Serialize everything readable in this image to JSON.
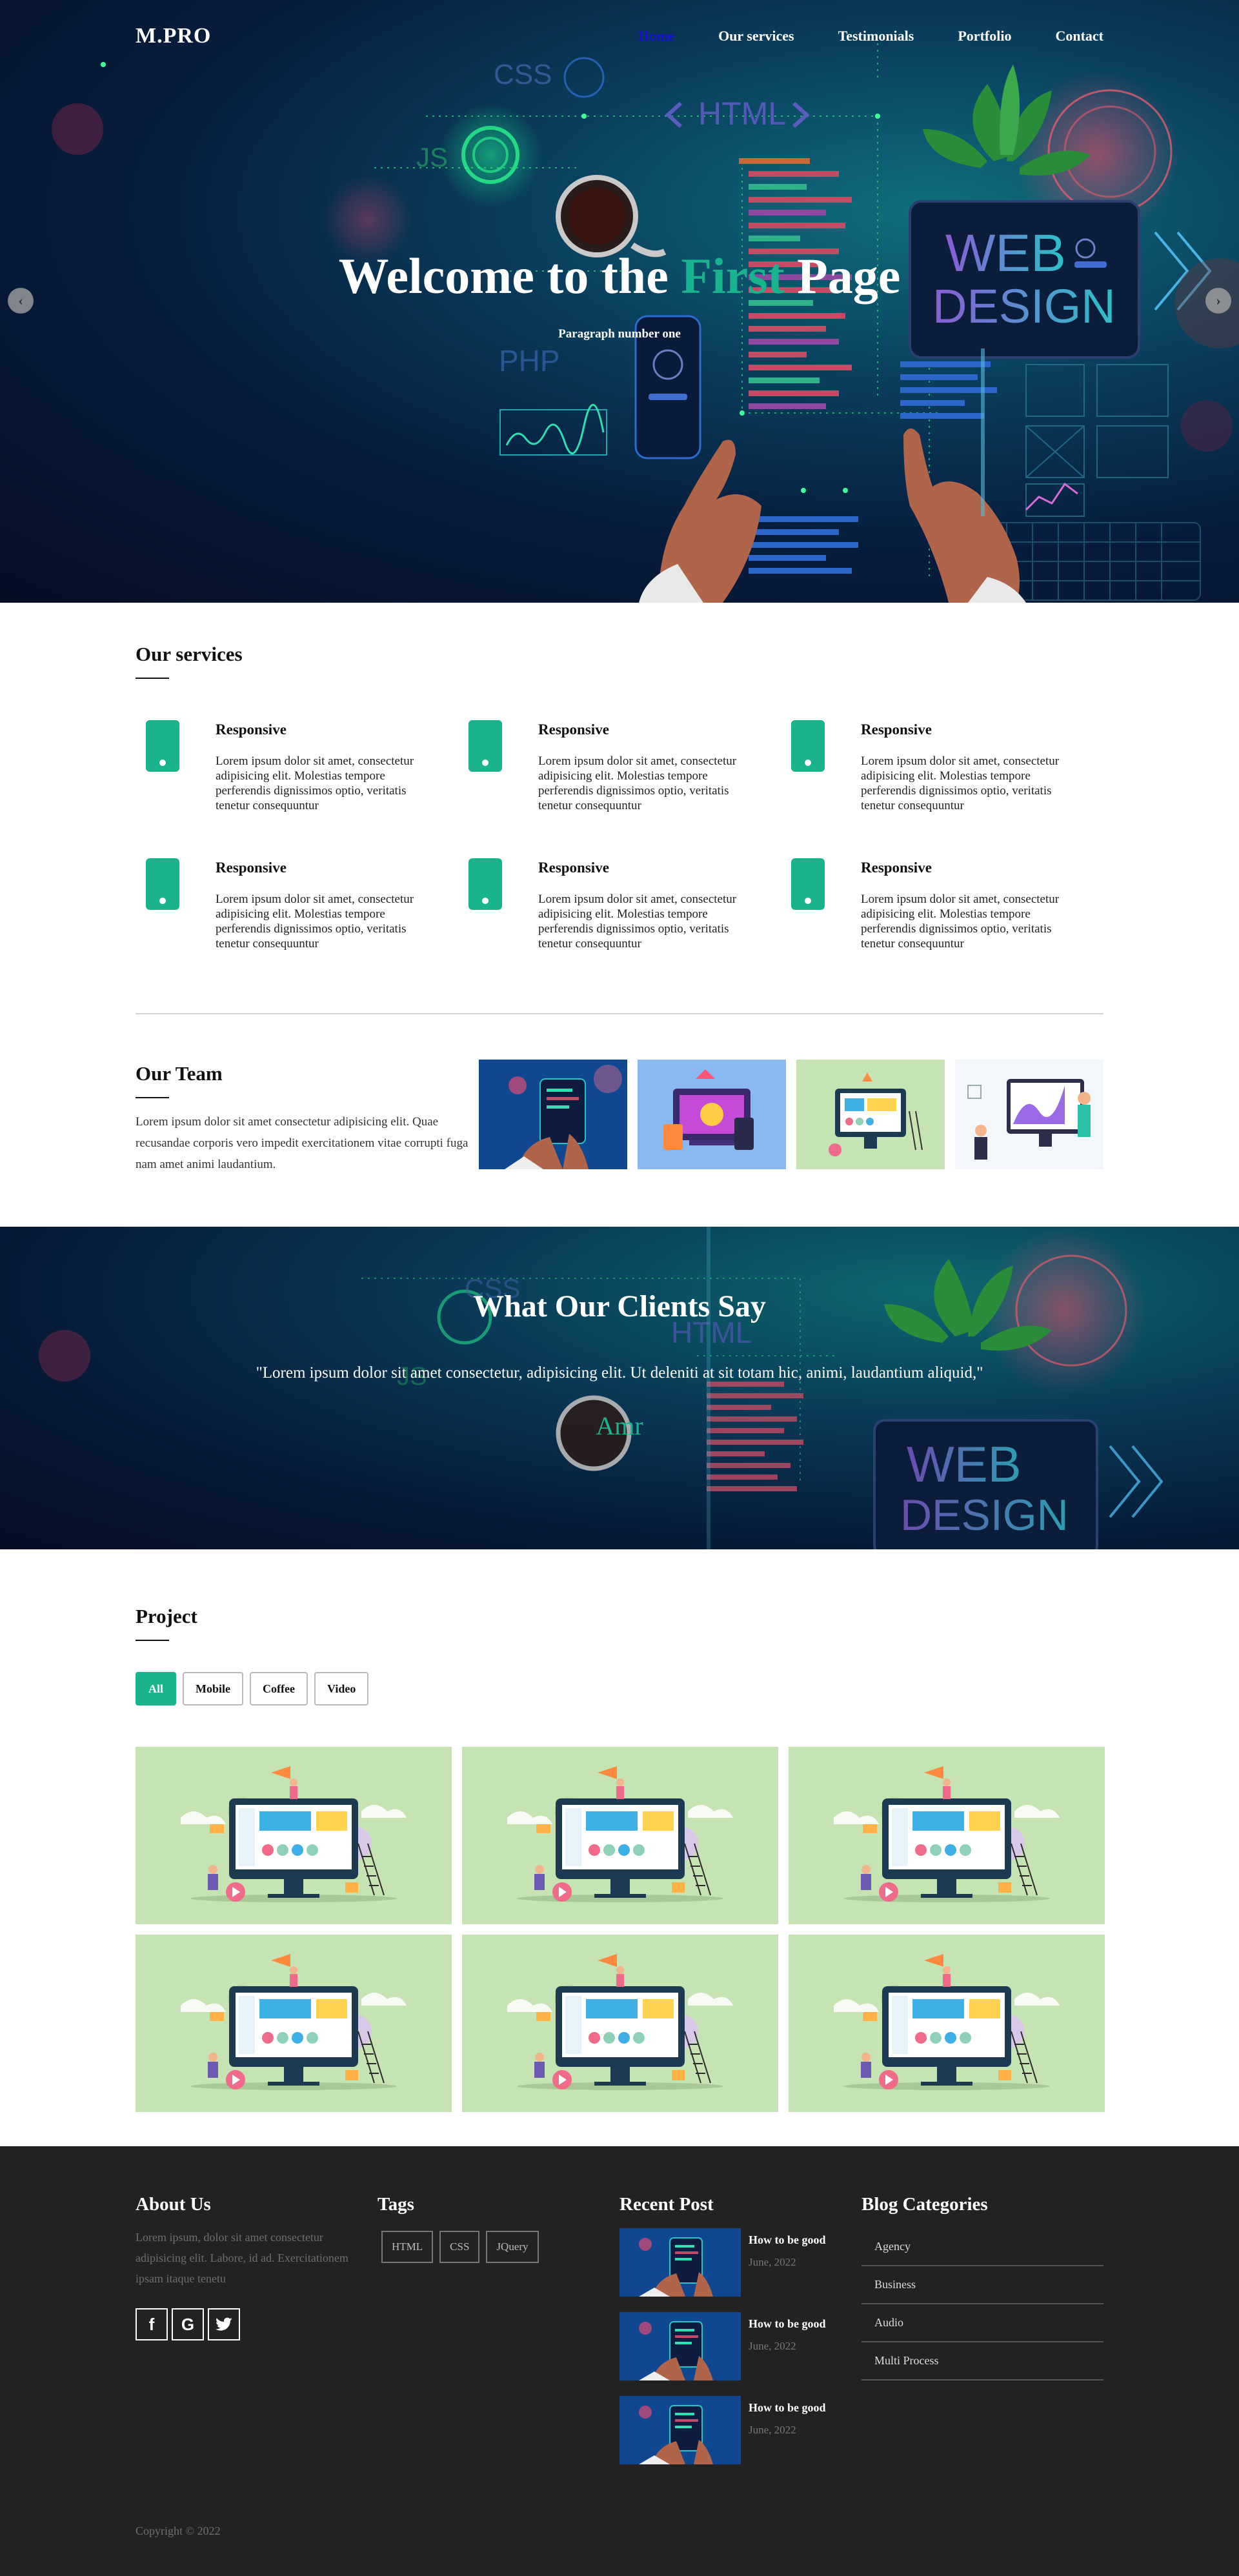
{
  "nav": {
    "logo": "M.PRO",
    "links": [
      "Home",
      "Our services",
      "Testimonials",
      "Portfolio",
      "Contact"
    ]
  },
  "hero": {
    "title_before": "Welcome to the ",
    "title_accent": "First",
    "title_after": " Page",
    "subtitle": "Paragraph number one",
    "prev_icon": "chevron-left-icon",
    "next_icon": "chevron-right-icon",
    "art_labels": {
      "css": "CSS",
      "html": "HTML",
      "js": "JS",
      "php": "PHP",
      "web": "WEB",
      "design": "DESIGN"
    }
  },
  "services": {
    "title": "Our services",
    "icon": "mobile-phone-icon",
    "items": [
      {
        "title": "Responsive",
        "text": "Lorem ipsum dolor sit amet, consectetur adipisicing elit. Molestias tempore perferendis dignissimos optio, veritatis tenetur consequuntur"
      },
      {
        "title": "Responsive",
        "text": "Lorem ipsum dolor sit amet, consectetur adipisicing elit. Molestias tempore perferendis dignissimos optio, veritatis tenetur consequuntur"
      },
      {
        "title": "Responsive",
        "text": "Lorem ipsum dolor sit amet, consectetur adipisicing elit. Molestias tempore perferendis dignissimos optio, veritatis tenetur consequuntur"
      },
      {
        "title": "Responsive",
        "text": "Lorem ipsum dolor sit amet, consectetur adipisicing elit. Molestias tempore perferendis dignissimos optio, veritatis tenetur consequuntur"
      },
      {
        "title": "Responsive",
        "text": "Lorem ipsum dolor sit amet, consectetur adipisicing elit. Molestias tempore perferendis dignissimos optio, veritatis tenetur consequuntur"
      },
      {
        "title": "Responsive",
        "text": "Lorem ipsum dolor sit amet, consectetur adipisicing elit. Molestias tempore perferendis dignissimos optio, veritatis tenetur consequuntur"
      }
    ]
  },
  "team": {
    "title": "Our Team",
    "text": "Lorem ipsum dolor sit amet consectetur adipisicing elit. Quae recusandae corporis vero impedit exercitationem vitae corrupti fuga nam amet animi laudantium."
  },
  "testimonials": {
    "title": "What Our Clients Say",
    "quote": "\"Lorem ipsum dolor sit amet consectetur, adipisicing elit. Ut deleniti at sit totam hic, animi, laudantium aliquid,\"",
    "name": "Amr"
  },
  "project": {
    "title": "Project",
    "filters": [
      "All",
      "Mobile",
      "Coffee",
      "Video"
    ]
  },
  "footer": {
    "about_title": "About Us",
    "about_text": "Lorem ipsum, dolor sit amet consectetur adipisicing elit. Labore, id ad. Exercitationem ipsam itaque tenetu",
    "socials": [
      {
        "icon": "facebook-icon",
        "glyph": "f"
      },
      {
        "icon": "google-icon",
        "glyph": "G"
      },
      {
        "icon": "twitter-icon",
        "glyph": "t"
      }
    ],
    "tags_title": "Tags",
    "tags": [
      "HTML",
      "CSS",
      "JQuery"
    ],
    "posts_title": "Recent Post",
    "posts": [
      {
        "title": "How to be good",
        "date": "June, 2022"
      },
      {
        "title": "How to be good",
        "date": "June, 2022"
      },
      {
        "title": "How to be good",
        "date": "June, 2022"
      }
    ],
    "categories_title": "Blog Categories",
    "categories": [
      "Agency",
      "Business",
      "Audio",
      "Multi Process"
    ],
    "copyright": "Copyright © 2022"
  },
  "colors": {
    "accent": "#19b48e",
    "active_nav": "#1a0dd8",
    "footer_bg": "#222222"
  }
}
